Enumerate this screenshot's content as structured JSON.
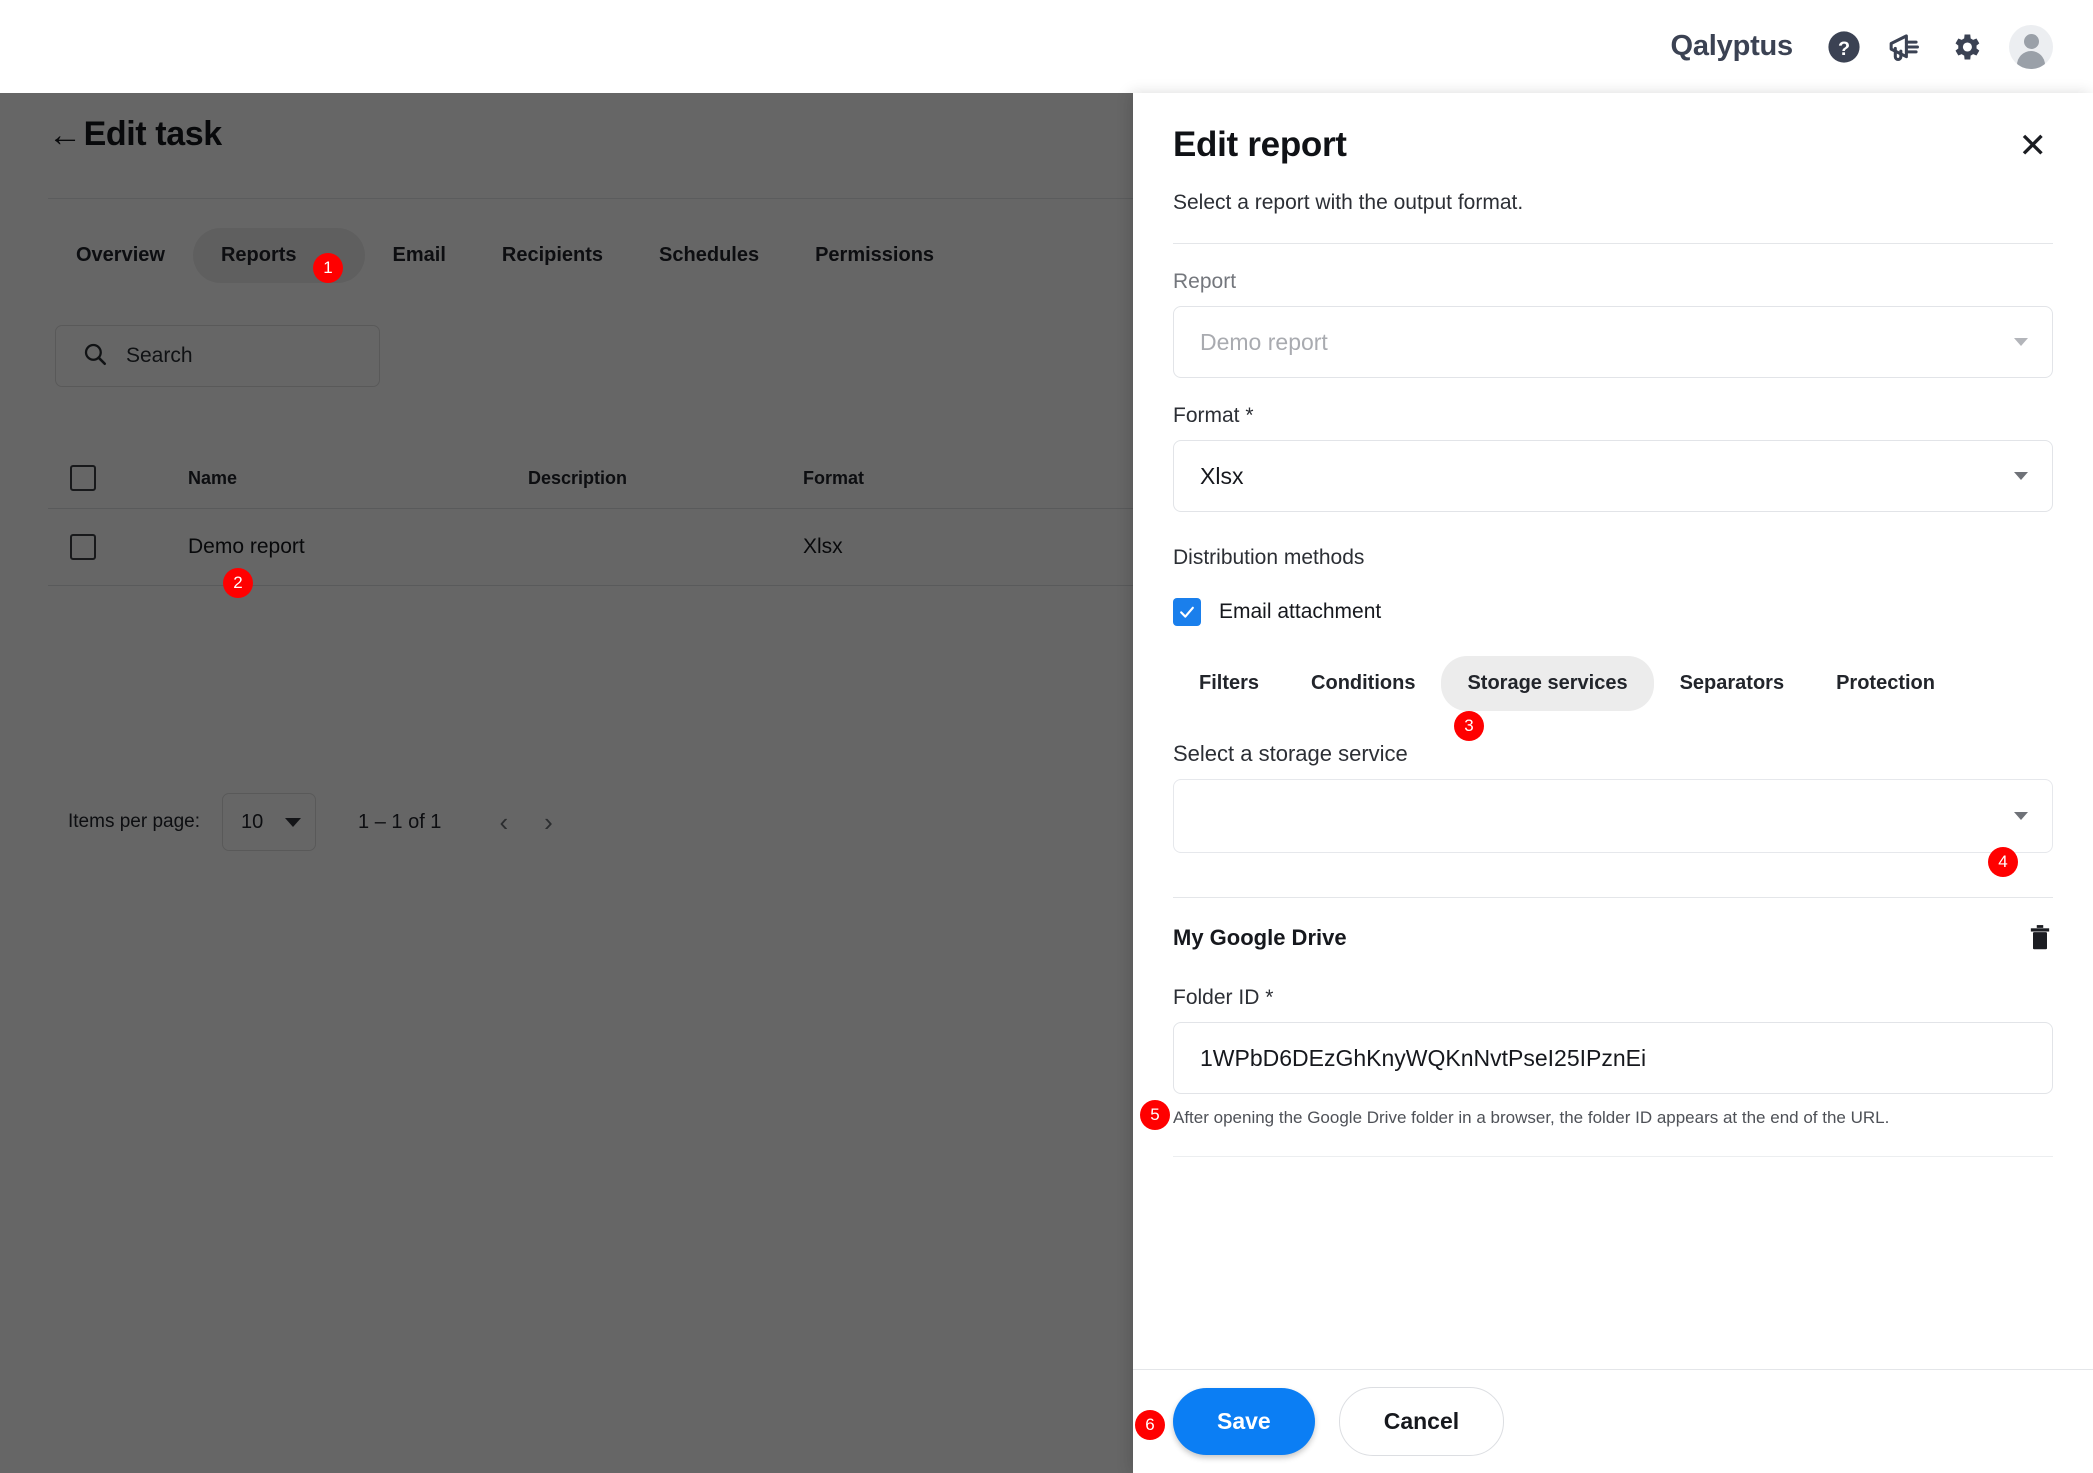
{
  "topbar": {
    "brand": "Qalyptus",
    "icons": [
      {
        "name": "help-icon",
        "label": "?"
      },
      {
        "name": "announcement-icon",
        "label": "megaphone"
      },
      {
        "name": "settings-gear-icon",
        "label": "gear"
      },
      {
        "name": "user-avatar",
        "label": "avatar"
      }
    ]
  },
  "page": {
    "title": "Edit task",
    "back_arrow": "←",
    "tabs": [
      {
        "label": "Overview",
        "active": false,
        "badge": null
      },
      {
        "label": "Reports",
        "active": true,
        "badge": "1"
      },
      {
        "label": "Email",
        "active": false,
        "badge": null
      },
      {
        "label": "Recipients",
        "active": false,
        "badge": null
      },
      {
        "label": "Schedules",
        "active": false,
        "badge": null
      },
      {
        "label": "Permissions",
        "active": false,
        "badge": null
      }
    ],
    "search": {
      "placeholder": "Search",
      "value": ""
    },
    "table": {
      "headers": [
        "",
        "Name",
        "Description",
        "Format"
      ],
      "rows": [
        {
          "name": "Demo report",
          "description": "",
          "format": "Xlsx",
          "badge": "2"
        }
      ]
    },
    "paginator": {
      "items_per_page_label": "Items per page:",
      "items_per_page_value": "10",
      "range": "1 – 1 of 1",
      "prev": "‹",
      "next": "›"
    }
  },
  "panel": {
    "title": "Edit report",
    "close": "✕",
    "subtitle": "Select a report with the output format.",
    "report": {
      "label": "Report",
      "value": "Demo report",
      "disabled": true
    },
    "format": {
      "label": "Format *",
      "value": "Xlsx"
    },
    "distribution": {
      "label": "Distribution methods",
      "email_attachment": {
        "label": "Email attachment",
        "checked": true
      }
    },
    "subtabs": [
      {
        "label": "Filters",
        "active": false,
        "badge": null
      },
      {
        "label": "Conditions",
        "active": false,
        "badge": null
      },
      {
        "label": "Storage services",
        "active": true,
        "badge": "3"
      },
      {
        "label": "Separators",
        "active": false,
        "badge": null
      },
      {
        "label": "Protection",
        "active": false,
        "badge": null
      }
    ],
    "storage": {
      "select_label": "Select a storage service",
      "select_value": "",
      "select_badge": "4",
      "service_name": "My Google Drive",
      "delete_icon": "trash-icon",
      "folder_id": {
        "label": "Folder ID *",
        "value": "1WPbD6DEzGhKnyWQKnNvtPseI25IPznEi",
        "hint": "After opening the Google Drive folder in a browser, the folder ID appears at the end of the URL.",
        "badge": "5"
      }
    },
    "footer": {
      "save": "Save",
      "cancel": "Cancel",
      "save_badge": "6"
    }
  },
  "colors": {
    "accent_blue": "#0b7ef4",
    "checkbox_blue": "#1a7fec",
    "badge_red": "#ff0000",
    "brand_dark": "#3b4253"
  }
}
